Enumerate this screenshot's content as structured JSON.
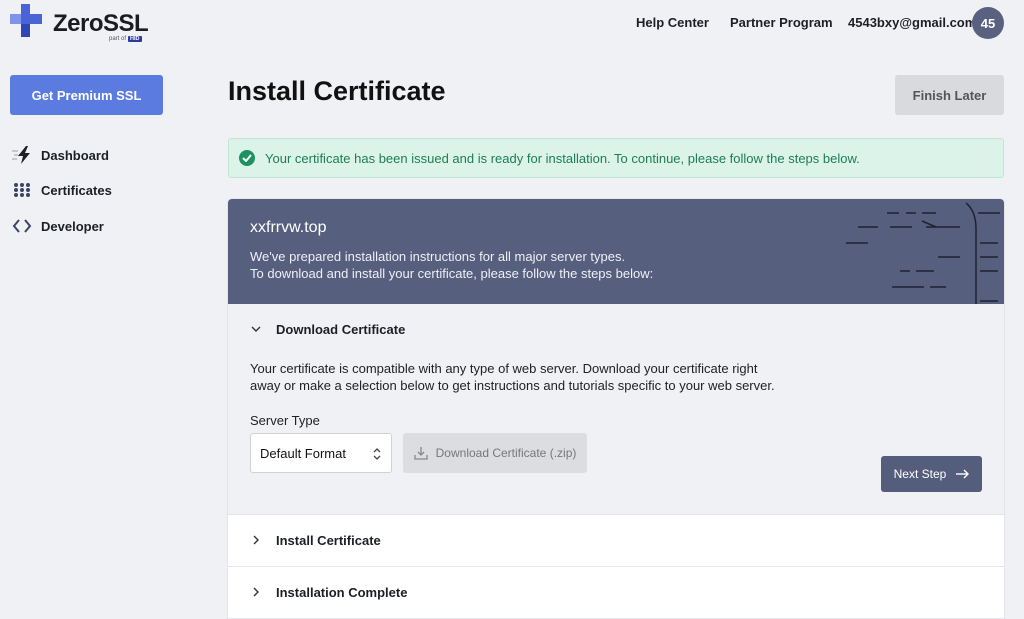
{
  "brand": {
    "name": "ZeroSSL",
    "part_of": "part of",
    "parent": "HID",
    "color": "#4a63d6"
  },
  "header": {
    "help_center": "Help Center",
    "partner_program": "Partner Program",
    "email": "4543bxy@gmail.com",
    "avatar": "45"
  },
  "sidebar": {
    "premium_label": "Get Premium SSL",
    "items": [
      {
        "label": "Dashboard",
        "icon": "lightning-icon"
      },
      {
        "label": "Certificates",
        "icon": "grid-icon"
      },
      {
        "label": "Developer",
        "icon": "code-icon"
      }
    ]
  },
  "main": {
    "title": "Install Certificate",
    "finish_later": "Finish Later",
    "alert": "Your certificate has been issued and is ready for installation. To continue, please follow the steps below.",
    "domain": "xxfrrvw.top",
    "intro_line1": "We've prepared installation instructions for all major server types.",
    "intro_line2": "To download and install your certificate, please follow the steps below:",
    "steps": [
      {
        "title": "Download Certificate",
        "expanded": true,
        "desc_line1": "Your certificate is compatible with any type of web server. Download your certificate right",
        "desc_line2": "away or make a selection below to get instructions and tutorials specific to your web server.",
        "server_type_label": "Server Type",
        "server_type_value": "Default Format",
        "download_label": "Download Certificate (.zip)",
        "next_label": "Next Step"
      },
      {
        "title": "Install Certificate",
        "expanded": false
      },
      {
        "title": "Installation Complete",
        "expanded": false
      }
    ]
  },
  "colors": {
    "accent": "#5b7be0",
    "header_band": "#575f7e",
    "success_bg": "#dbf3e8",
    "success_text": "#1d7e55"
  }
}
